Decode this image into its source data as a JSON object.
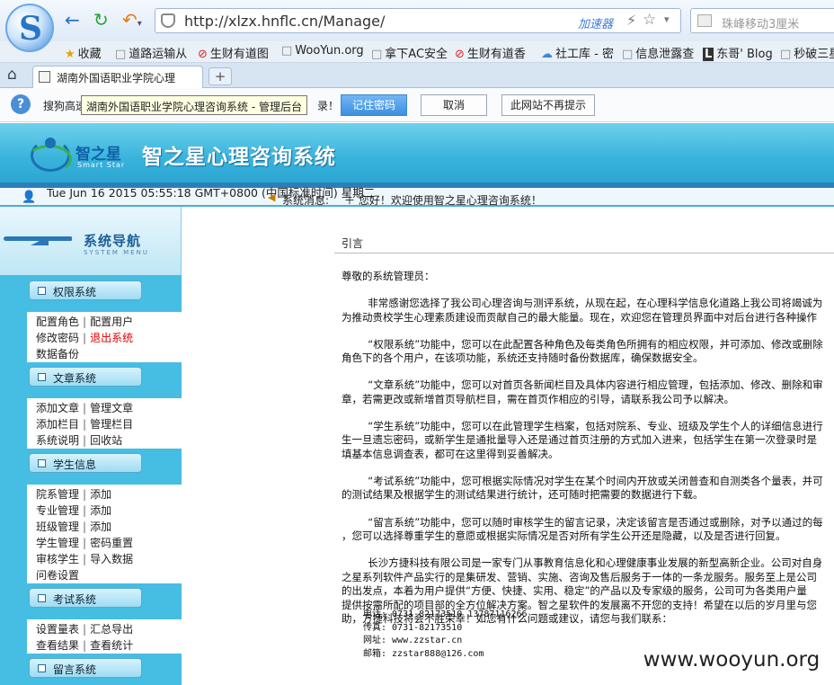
{
  "browser": {
    "logo_letter": "S",
    "url": "http://xlzx.hnflc.cn/Manage/",
    "accelerator_label": "加速器",
    "search_placeholder": "珠峰移动3厘米",
    "bookmarks": [
      "收藏",
      "道路运输从",
      "生财有道图",
      "WooYun.org",
      "拿下AC安全",
      "生财有道香",
      "社工库 - 密",
      "信息泄露查",
      "东哥' Blog",
      "秒破三星"
    ],
    "tab_title": "湖南外国语职业学院心理",
    "new_tab_label": "+",
    "password_bar": {
      "prefix": "搜狗高速",
      "tooltip": "湖南外国语职业学院心理咨询系统 - 管理后台",
      "suffix": "录！",
      "remember": "记住密码",
      "cancel": "取消",
      "never": "此网站不再提示"
    }
  },
  "site": {
    "brand_name": "智之星",
    "brand_sub": "Smart Star",
    "title": "智之星心理咨询系统",
    "datetime": "Tue Jun 16 2015 05:55:18 GMT+0800\n(中国标准时间) 星期二",
    "msg_label": "系统消息:",
    "msg_text": "＋ 您好！欢迎使用智之星心理咨询系统！"
  },
  "sidebar": {
    "title": "系统导航",
    "subtitle": "SYSTEM MENU",
    "sections": [
      {
        "label": "权限系统",
        "rows": [
          [
            "配置角色",
            "配置用户"
          ],
          [
            "修改密码",
            "退出系统"
          ],
          [
            "数据备份"
          ]
        ]
      },
      {
        "label": "文章系统",
        "rows": [
          [
            "添加文章",
            "管理文章"
          ],
          [
            "添加栏目",
            "管理栏目"
          ],
          [
            "系统说明",
            "回收站"
          ]
        ]
      },
      {
        "label": "学生信息",
        "rows": [
          [
            "院系管理",
            "添加"
          ],
          [
            "专业管理",
            "添加"
          ],
          [
            "班级管理",
            "添加"
          ],
          [
            "学生管理",
            "密码重置"
          ],
          [
            "审核学生",
            "导入数据"
          ],
          [
            "问卷设置"
          ]
        ]
      },
      {
        "label": "考试系统",
        "rows": [
          [
            "设置量表",
            "汇总导出"
          ],
          [
            "查看结果",
            "查看统计"
          ]
        ]
      },
      {
        "label": "留言系统",
        "rows": []
      }
    ]
  },
  "content": {
    "title": "引言",
    "paragraphs": [
      "尊敬的系统管理员：",
      "        非常感谢您选择了我公司心理咨询与测评系统，从现在起，在心理科学信息化道路上我公司将竭诚为\n为推动贵校学生心理素质建设而贡献自己的最大能量。现在，欢迎您在管理员界面中对后台进行各种操作",
      "        “权限系统”功能中，您可以在此配置各种角色及每类角色所拥有的相应权限，并可添加、修改或删除\n角色下的各个用户，在该项功能，系统还支持随时备份数据库，确保数据安全。",
      "        “文章系统”功能中，您可以对首页各新闻栏目及具体内容进行相应管理，包括添加、修改、删除和审\n章，若需更改或新增首页导航栏目，需在首页作相应的引导，请联系我公司予以解决。",
      "        “学生系统”功能中，您可以在此管理学生档案，包括对院系、专业、班级及学生个人的详细信息进行\n生一旦遗忘密码，或新学生是通批量导入还是通过首页注册的方式加入进来，包括学生在第一次登录时是\n填基本信息调查表，都可在这里得到妥善解决。",
      "        “考试系统”功能中，您可根据实际情况对学生在某个时间内开放或关闭普查和自测类各个量表，并可\n的测试结果及根据学生的测试结果进行统计，还可随时把需要的数据进行下载。",
      "        “留言系统”功能中，您可以随时审核学生的留言记录，决定该留言是否通过或删除，对予以通过的每\n，您可以选择尊重学生的意愿或根据实际情况是否对所有学生公开还是隐藏，以及是否进行回复。",
      "        长沙方捷科技有限公司是一家专门从事教育信息化和心理健康事业发展的新型高新企业。公司对自身\n之星系列软件产品实行的是集研发、营销、实施、咨询及售后服务于一体的一条龙服务。服务至上是公司\n的出发点，本着为用户提供“方便、快捷、实用、稳定”的产品以及专家级的服务，公司可为各类用户量\n提供按需所配的项目部的全方位解决方案。智之星软件的发展离不开您的支持！希望在以后的岁月里与您\n助，方捷科技将会不胜荣幸！如您有什么问题或建议，请您与我们联系："
    ],
    "contact": "电话: 0731-82173510 13787116266\n传真: 0731-82173510\n网址: www.zzstar.cn\n邮箱: zzstar888@126.com"
  },
  "watermark": "www.wooyun.org"
}
